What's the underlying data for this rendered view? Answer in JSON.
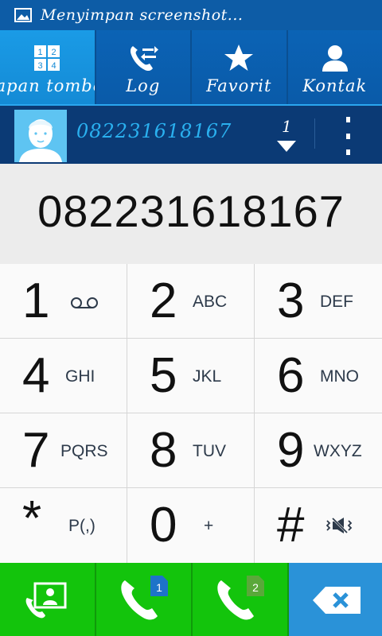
{
  "status": {
    "text": "Menyimpan screenshot..."
  },
  "tabs": [
    {
      "label": "Papan tombol",
      "icon": "keypad-icon",
      "active": true
    },
    {
      "label": "Log",
      "icon": "call-log-icon",
      "active": false
    },
    {
      "label": "Favorit",
      "icon": "star-icon",
      "active": false
    },
    {
      "label": "Kontak",
      "icon": "person-icon",
      "active": false
    }
  ],
  "contact": {
    "number": "082231618167",
    "sim": "1"
  },
  "display": {
    "number": "082231618167"
  },
  "keys": [
    {
      "digit": "1",
      "letters": "",
      "icon": "voicemail-icon"
    },
    {
      "digit": "2",
      "letters": "ABC"
    },
    {
      "digit": "3",
      "letters": "DEF"
    },
    {
      "digit": "4",
      "letters": "GHI"
    },
    {
      "digit": "5",
      "letters": "JKL"
    },
    {
      "digit": "6",
      "letters": "MNO"
    },
    {
      "digit": "7",
      "letters": "PQRS"
    },
    {
      "digit": "8",
      "letters": "TUV"
    },
    {
      "digit": "9",
      "letters": "WXYZ"
    },
    {
      "digit": "*",
      "letters": "P(,)"
    },
    {
      "digit": "0",
      "letters": "+"
    },
    {
      "digit": "#",
      "letters": "",
      "icon": "vibrate-mute-icon"
    }
  ],
  "actions": {
    "sim1_label": "1",
    "sim2_label": "2"
  },
  "colors": {
    "status_bar": "#0d5ca6",
    "tab_active": "#1a9be6",
    "contact_bar": "#0b3a75",
    "call_green": "#13c40c",
    "delete_blue": "#2a92d8"
  }
}
